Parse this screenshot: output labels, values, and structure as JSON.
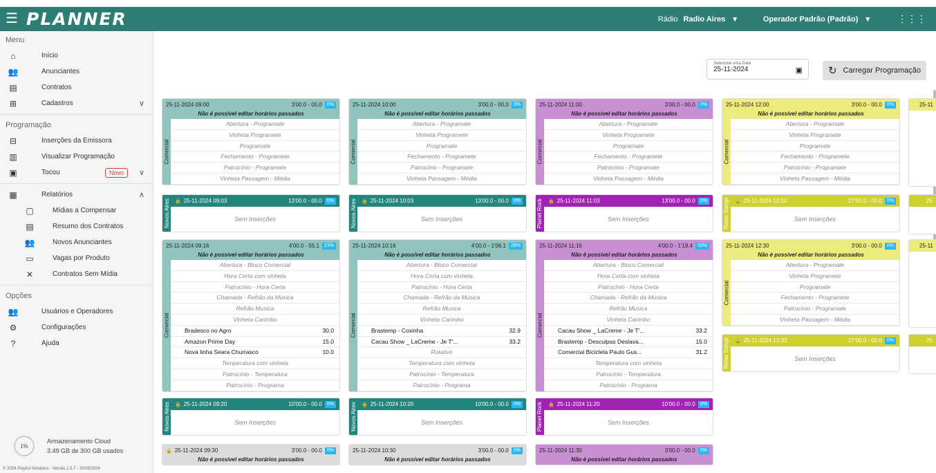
{
  "topbar": {
    "logo": "PLANNER",
    "radio_label": "Rádio",
    "radio_value": "Radio Aires",
    "operator": "Operador Padrão (Padrão)"
  },
  "sidebar": {
    "menu_title": "Menu",
    "menu_items": [
      "Início",
      "Anunciantes",
      "Contratos",
      "Cadastros"
    ],
    "prog_title": "Programação",
    "prog_items": [
      "Inserções da Emissora",
      "Visualizar Programação",
      "Tocou"
    ],
    "novo_badge": "Novo",
    "relatorios": "Relatórios",
    "relatorios_items": [
      "Mídias a Compensar",
      "Resumo dos Contratos",
      "Novos Anunciantes",
      "Vagas por Produto",
      "Contratos Sem Mídia"
    ],
    "opcoes_title": "Opções",
    "opcoes_items": [
      "Usuários e Operadores",
      "Configurações",
      "Ajuda"
    ],
    "storage_pct": "1%",
    "storage_title": "Armazenamento Cloud",
    "storage_used": "3.49 GB de 300 GB usados",
    "footer": "© 2024 Playlist Solutions - Versão 1.5.7 - 20/08/2024"
  },
  "main": {
    "date_label": "Selecione uma Data",
    "date_value": "25-11-2024",
    "load_button": "Carregar Programação",
    "no_edit": "Não é possível editar horários passados",
    "sem_insercoes": "Sem Inserções",
    "comercial": "Comercial",
    "block1_rows": [
      "Abertura - Programate",
      "Vinheta Programete",
      "Programate",
      "Fechamento - Programete",
      "Patrocínio - Programate",
      "Vinheta Passagem - Média"
    ],
    "block2_pre": [
      "Abertura - Bloco Comercial",
      "Hora Certa com vinheta",
      "Patrocínio - Hora Certa",
      "Chamada - Refrão da Música",
      "Refrão Musica",
      "Vinheta Carimbo"
    ],
    "block2_post": [
      "Temperatura com vinheta",
      "Patrocínio - Temperatura",
      "Patrocínio - Programa"
    ],
    "rotativo": "Rotativo",
    "columns": [
      {
        "c1": {
          "dt": "25-11-2024 09:00",
          "time": "3'00.0 - 00.0",
          "pct": "0%"
        },
        "c2": {
          "label": "Novos Aires",
          "dt": "25-11-2024 09:03",
          "time": "13'00.0 - 00.0",
          "pct": "0%"
        },
        "c3": {
          "dt": "25-11-2024 09:16",
          "time": "4'00.0 - 55.1",
          "pct": "23%",
          "ads": [
            {
              "name": "Bradesco no Agro",
              "dur": "30.0"
            },
            {
              "name": "Amazon Prime Day",
              "dur": "15.0"
            },
            {
              "name": "Nova linha Seara Churrasco",
              "dur": "10.0"
            }
          ]
        },
        "c4": {
          "label": "Novos Aires",
          "dt": "25-11-2024 09:20",
          "time": "10'00.0 - 00.0",
          "pct": "0%"
        },
        "c5": {
          "dt": "25-11-2024 09:30",
          "time": "3'00.0 - 00.0",
          "pct": "0%"
        }
      },
      {
        "c1": {
          "dt": "25-11-2024 10:00",
          "time": "3'00.0 - 00.0",
          "pct": "0%"
        },
        "c2": {
          "label": "Novos Aires",
          "dt": "25-11-2024 10:03",
          "time": "13'00.0 - 00.0",
          "pct": "0%"
        },
        "c3": {
          "dt": "25-11-2024 10:16",
          "time": "4'00.0 - 1'06.1",
          "pct": "28%",
          "ads": [
            {
              "name": "Brastemp - Coxinha",
              "dur": "32.9"
            },
            {
              "name": "Cacau Show _ LaCreme - Je T'...",
              "dur": "33.2"
            }
          ]
        },
        "c4": {
          "label": "Novos Aires",
          "dt": "25-11-2024 10:20",
          "time": "10'00.0 - 00.0",
          "pct": "0%"
        },
        "c5": {
          "dt": "25-11-2024 10:30",
          "time": "3'00.0 - 00.0",
          "pct": "0%"
        }
      },
      {
        "c1": {
          "dt": "25-11-2024 11:00",
          "time": "3'00.0 - 00.0",
          "pct": "0%"
        },
        "c2": {
          "label": "Planet Rock",
          "dt": "25-11-2024 11:03",
          "time": "13'00.0 - 00.0",
          "pct": "0%"
        },
        "c3": {
          "dt": "25-11-2024 11:16",
          "time": "4'00.0 - 1'19.4",
          "pct": "33%",
          "ads": [
            {
              "name": "Cacau Show _ LaCreme - Je T'...",
              "dur": "33.2"
            },
            {
              "name": "Brastemp - Desculpas Deslava...",
              "dur": "15.0"
            },
            {
              "name": "Comercial Bicicleta Paulo Gus...",
              "dur": "31.2"
            }
          ]
        },
        "c4": {
          "label": "Planet Rock",
          "dt": "25-11-2024 11:20",
          "time": "10'00.0 - 00.0",
          "pct": "0%"
        },
        "c5": {
          "dt": "25-11-2024 11:30",
          "time": "3'00.0 - 00.0",
          "pct": "0%"
        }
      },
      {
        "c1": {
          "dt": "25-11-2024 12:00",
          "time": "3'00.0 - 00.0",
          "pct": "0%"
        },
        "c2": {
          "label": "Relax Songs",
          "dt": "25-11-2024 12:03",
          "time": "27'00.0 - 00.0",
          "pct": "0%"
        },
        "c3": {
          "dt": "25-11-2024 12:30",
          "time": "3'00.0 - 00.0",
          "pct": "0%"
        },
        "c4": {
          "label": "Relax Songs",
          "dt": "25-11-2024 12:33",
          "time": "27'00.0 - 00.0",
          "pct": "0%"
        }
      }
    ],
    "partial_col": {
      "dt": "25-11",
      "label_short": "25"
    }
  }
}
